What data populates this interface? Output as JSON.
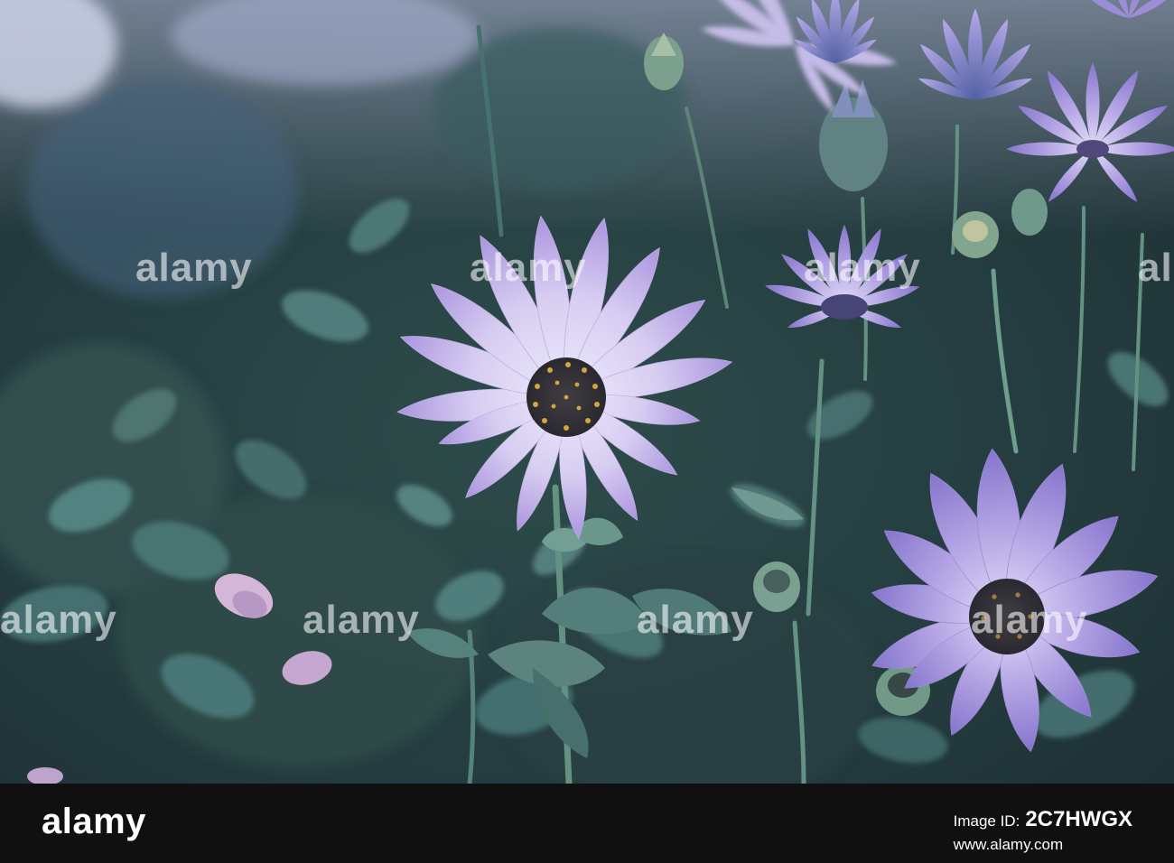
{
  "photo": {
    "palette": {
      "background_dark": "#1c3438",
      "foliage": "#3e6e6a",
      "petal_light": "#e2d8f4",
      "petal_purple": "#9a82d6",
      "petal_deep": "#6f66b4",
      "center": "#2c2a2e",
      "pollen": "#d9a431"
    }
  },
  "watermark": {
    "text": "alamy"
  },
  "footer": {
    "logo": "alamy",
    "image_id_label": "Image ID:",
    "image_id": "2C7HWGX",
    "site": "www.alamy.com"
  }
}
